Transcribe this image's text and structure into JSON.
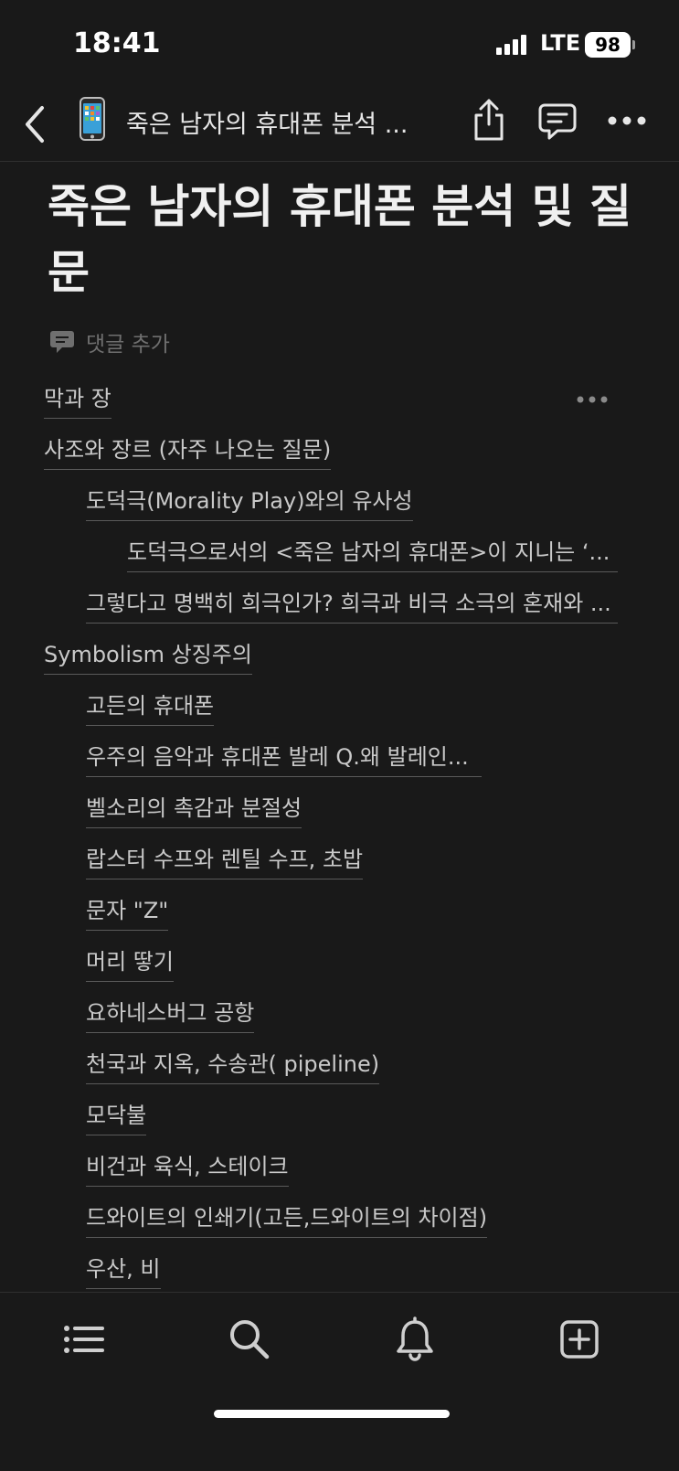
{
  "status_bar": {
    "time": "18:41",
    "network": "LTE",
    "battery": "98"
  },
  "header": {
    "page_icon": "mobile-phone-emoji",
    "title": "죽은 남자의 휴대폰 분석 ..."
  },
  "page": {
    "title": "죽은 남자의 휴대폰 분석 및 질문",
    "add_comment_label": "댓글 추가"
  },
  "toc": {
    "items": [
      {
        "label": "막과 장",
        "level": 0
      },
      {
        "label": "사조와 장르 (자주 나오는 질문)",
        "level": 0
      },
      {
        "label": "도덕극(Morality Play)와의 유사성",
        "level": 1
      },
      {
        "label": "도덕극으로서의 <죽은 남자의 휴대폰>이 지니는 ‘...",
        "level": 2
      },
      {
        "label": "그렇다고 명백히 희극인가? 희극과 비극 소극의 혼재와 ...",
        "level": 1
      },
      {
        "label": "Symbolism 상징주의",
        "level": 0
      },
      {
        "label": "고든의 휴대폰",
        "level": 1
      },
      {
        "label": "우주의 음악과 휴대폰 발레 Q.왜 발레인...",
        "level": 1
      },
      {
        "label": "벨소리의 촉감과 분절성",
        "level": 1
      },
      {
        "label": "랍스터 수프와 렌틸 수프, 초밥",
        "level": 1
      },
      {
        "label": "문자 \"Z\"",
        "level": 1
      },
      {
        "label": "머리 땋기",
        "level": 1
      },
      {
        "label": "요하네스버그 공항",
        "level": 1
      },
      {
        "label": "천국과 지옥, 수송관( pipeline)",
        "level": 1
      },
      {
        "label": "모닥불",
        "level": 1
      },
      {
        "label": "비건과 육식, 스테이크",
        "level": 1
      },
      {
        "label": "드와이트의 인쇄기(고든,드와이트의 차이점)",
        "level": 1
      },
      {
        "label": "우산, 비",
        "level": 1
      }
    ]
  },
  "tabbar": {
    "icons": [
      "list-icon",
      "search-icon",
      "bell-icon",
      "plus-square-icon"
    ]
  }
}
